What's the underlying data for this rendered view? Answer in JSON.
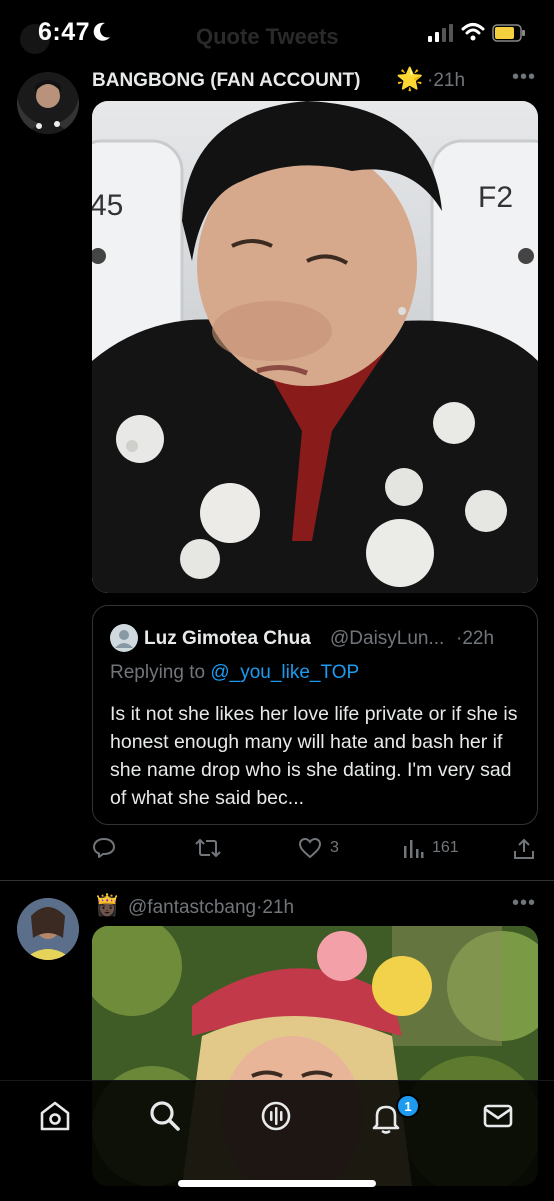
{
  "status_bar": {
    "time": "6:47"
  },
  "header": {
    "title": "Quote Tweets"
  },
  "tweet1": {
    "display_name": "BANGBONG (FAN ACCOUNT)",
    "name_emoji": "🌟",
    "time": "21h",
    "media_text_left": "45",
    "media_text_right": "F2",
    "quote": {
      "display_name": "Luz Gimotea Chua",
      "handle": "@DaisyLun...",
      "time": "22h",
      "replying_prefix": "Replying to",
      "replying_handle": "@_you_like_TOP",
      "body": "Is it not she likes her love life private or if she is honest enough  many will hate and bash her if she name drop who is she dating. I'm very sad of what she said bec..."
    },
    "actions": {
      "replies": "",
      "retweets": "",
      "likes": "3",
      "views": "161"
    }
  },
  "tweet2": {
    "name_emoji": "👸🏿",
    "handle": "@fantastcbang",
    "time": "21h"
  },
  "nav": {
    "notifications_badge": "1"
  },
  "colors": {
    "accent": "#1d9bf0",
    "background": "#000000",
    "muted": "#71767b",
    "border": "#2f3336"
  },
  "icons": [
    "moon-icon",
    "signal-icon",
    "wifi-icon",
    "battery-icon",
    "more-icon",
    "reply-icon",
    "retweet-icon",
    "like-icon",
    "views-icon",
    "share-icon",
    "home-icon",
    "search-icon",
    "spaces-icon",
    "bell-icon",
    "mail-icon"
  ]
}
